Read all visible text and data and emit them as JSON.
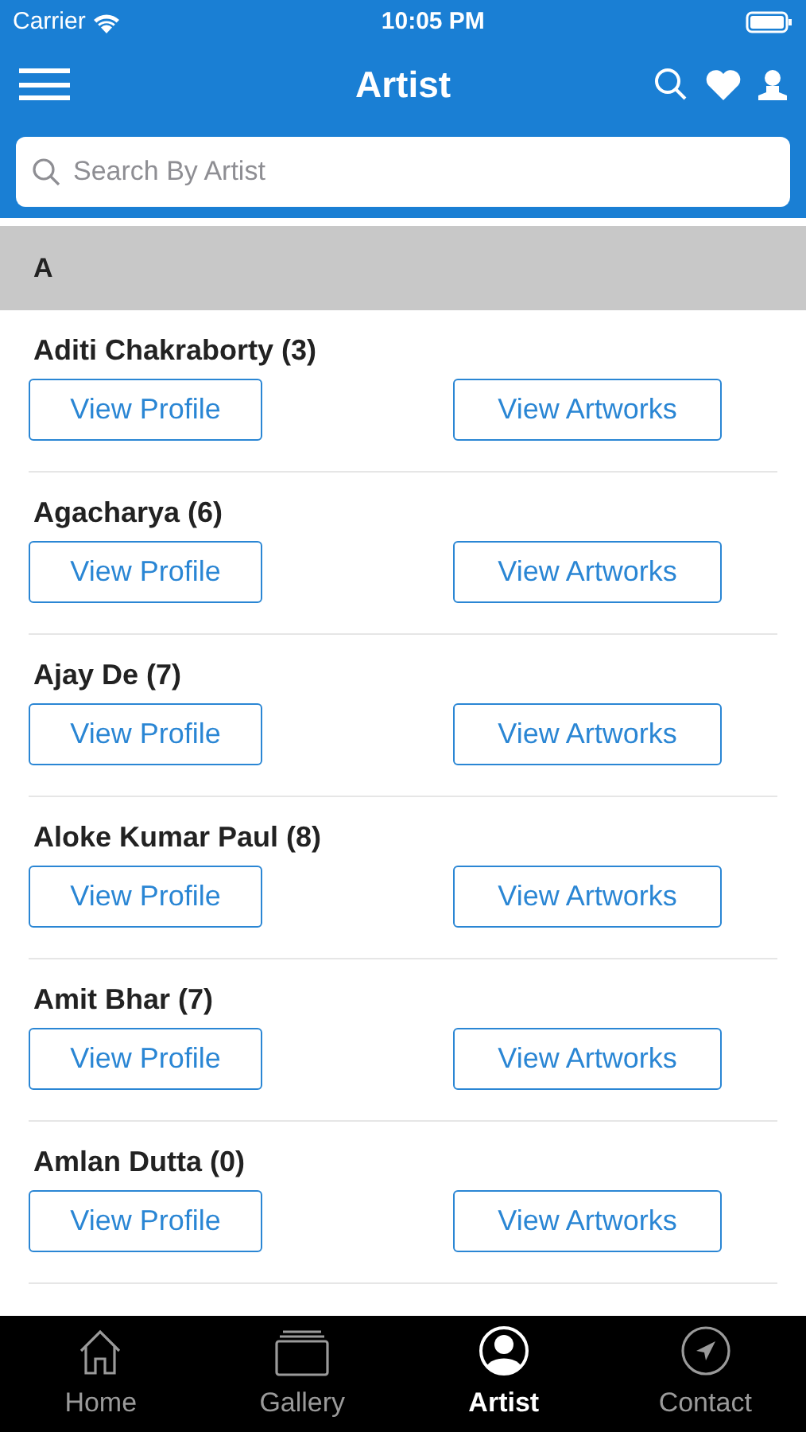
{
  "status_bar": {
    "carrier": "Carrier",
    "time": "10:05 PM"
  },
  "nav": {
    "title": "Artist"
  },
  "search": {
    "placeholder": "Search By Artist"
  },
  "section": {
    "letter": "A"
  },
  "artists": [
    {
      "name": "Aditi Chakraborty (3)",
      "profile": "View Profile",
      "artworks": "View Artworks"
    },
    {
      "name": "Agacharya (6)",
      "profile": "View Profile",
      "artworks": "View Artworks"
    },
    {
      "name": "Ajay De (7)",
      "profile": "View Profile",
      "artworks": "View Artworks"
    },
    {
      "name": "Aloke Kumar Paul (8)",
      "profile": "View Profile",
      "artworks": "View Artworks"
    },
    {
      "name": "Amit Bhar (7)",
      "profile": "View Profile",
      "artworks": "View Artworks"
    },
    {
      "name": "Amlan Dutta (0)",
      "profile": "View Profile",
      "artworks": "View Artworks"
    }
  ],
  "tabs": [
    {
      "label": "Home",
      "kind": "home",
      "selected": false
    },
    {
      "label": "Gallery",
      "kind": "gallery",
      "selected": false
    },
    {
      "label": "Artist",
      "kind": "artist",
      "selected": true
    },
    {
      "label": "Contact",
      "kind": "contact",
      "selected": false
    }
  ]
}
